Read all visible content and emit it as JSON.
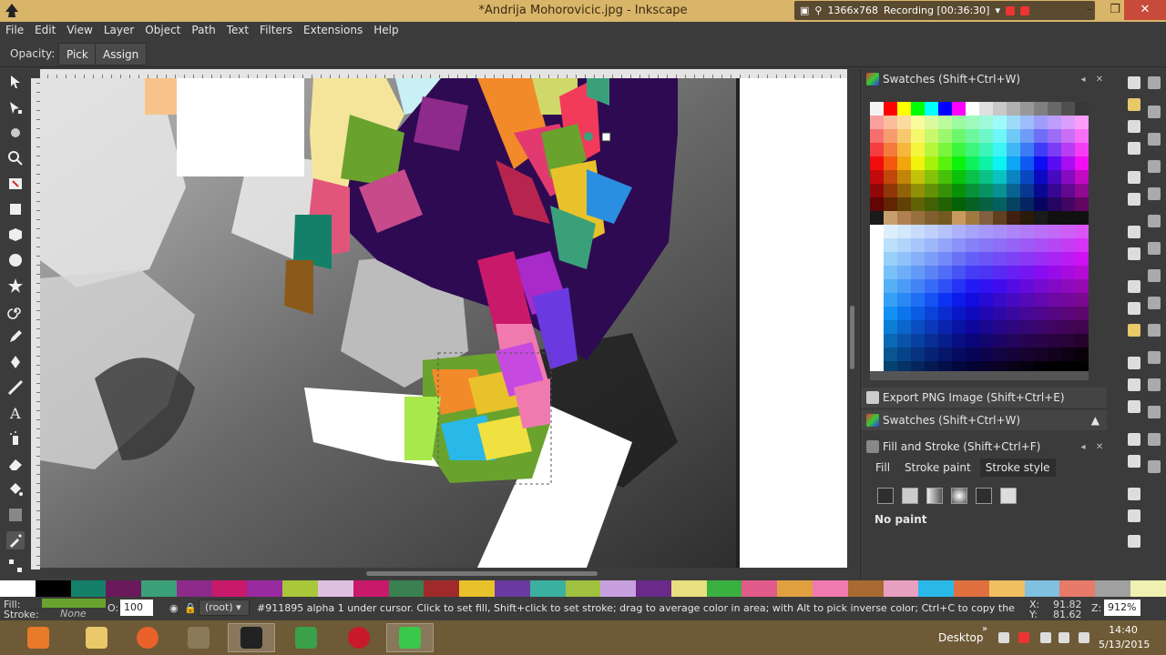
{
  "window": {
    "title": "*Andrija Mohorovicic.jpg - Inkscape",
    "recorder": {
      "resolution": "1366x768",
      "status": "Recording [00:36:30]"
    }
  },
  "menu": [
    "File",
    "Edit",
    "View",
    "Layer",
    "Object",
    "Path",
    "Text",
    "Filters",
    "Extensions",
    "Help"
  ],
  "tool_controls": {
    "opacity_label": "Opacity:",
    "pick_label": "Pick",
    "assign_label": "Assign"
  },
  "dock": {
    "swatches_title": "Swatches (Shift+Ctrl+W)",
    "export_title": "Export PNG Image (Shift+Ctrl+E)",
    "swatches_collapsed_title": "Swatches (Shift+Ctrl+W)",
    "fill_stroke_title": "Fill and Stroke (Shift+Ctrl+F)",
    "tabs": [
      "Fill",
      "Stroke paint",
      "Stroke style"
    ],
    "no_paint": "No paint"
  },
  "status": {
    "fill_label": "Fill:",
    "stroke_label": "Stroke:",
    "stroke_value": "None",
    "opacity_label": "O:",
    "opacity_value": "100",
    "layer": "(root)",
    "message": "#911895 alpha 1 under cursor. Click to set fill, Shift+click to set stroke; drag to average color in area; with Alt to pick inverse color; Ctrl+C to copy the",
    "x_label": "X:",
    "y_label": "Y:",
    "x_value": "91.82",
    "y_value": "81.62",
    "zoom_label": "Z:",
    "zoom_value": "912%"
  },
  "taskbar": {
    "desktop_label": "Desktop",
    "time": "14:40",
    "date": "5/13/2015"
  },
  "colors": {
    "accent_fill": "#6aa22e",
    "picked_color": "#911895",
    "dark_purple": "#2e0a52"
  }
}
